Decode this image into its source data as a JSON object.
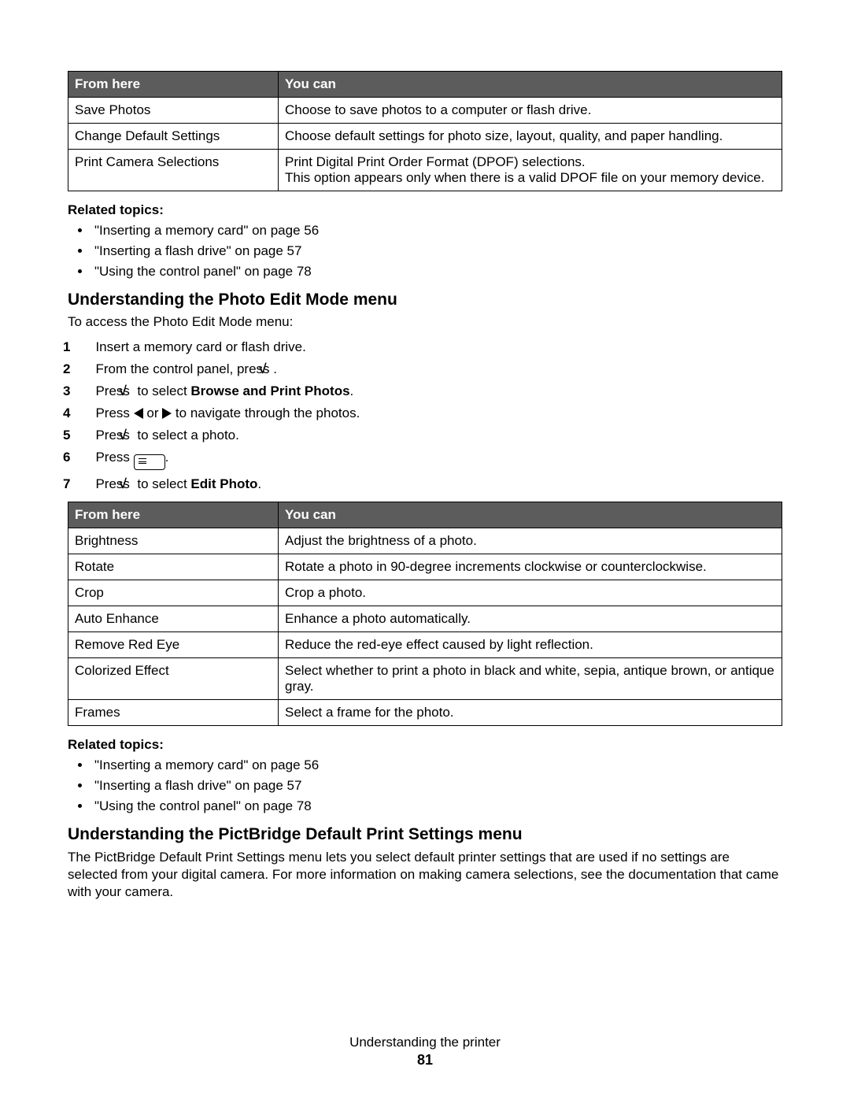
{
  "table1": {
    "headers": {
      "from": "From here",
      "you": "You can"
    },
    "rows": [
      {
        "from": "Save Photos",
        "you": "Choose to save photos to a computer or flash drive."
      },
      {
        "from": "Change Default Settings",
        "you": "Choose default settings for photo size, layout, quality, and paper handling."
      },
      {
        "from": "Print Camera Selections",
        "you": "Print Digital Print Order Format (DPOF) selections.\nThis option appears only when there is a valid DPOF file on your memory device."
      }
    ]
  },
  "related1": {
    "heading": "Related topics:",
    "items": [
      "\"Inserting a memory card\" on page 56",
      "\"Inserting a flash drive\" on page 57",
      "\"Using the control panel\" on page 78"
    ]
  },
  "section_photo_edit": {
    "heading": "Understanding the Photo Edit Mode menu",
    "intro": "To access the Photo Edit Mode menu:",
    "steps": {
      "s1": "Insert a memory card or flash drive.",
      "s2a": "From the control panel, press ",
      "s3a": "Press ",
      "s3b": " to select ",
      "s3c": "Browse and Print Photos",
      "s4a": "Press ",
      "s4b": " or ",
      "s4c": " to navigate through the photos.",
      "s5a": "Press ",
      "s5b": " to select a photo.",
      "s6a": "Press ",
      "s7a": "Press ",
      "s7b": " to select ",
      "s7c": "Edit Photo",
      "dot": "."
    }
  },
  "table2": {
    "headers": {
      "from": "From here",
      "you": "You can"
    },
    "rows": [
      {
        "from": "Brightness",
        "you": "Adjust the brightness of a photo."
      },
      {
        "from": "Rotate",
        "you": "Rotate a photo in 90-degree increments clockwise or counterclockwise."
      },
      {
        "from": "Crop",
        "you": "Crop a photo."
      },
      {
        "from": "Auto Enhance",
        "you": "Enhance a photo automatically."
      },
      {
        "from": "Remove Red Eye",
        "you": "Reduce the red-eye effect caused by light reflection."
      },
      {
        "from": "Colorized Effect",
        "you": "Select whether to print a photo in black and white, sepia, antique brown, or antique gray."
      },
      {
        "from": "Frames",
        "you": "Select a frame for the photo."
      }
    ]
  },
  "related2": {
    "heading": "Related topics:",
    "items": [
      "\"Inserting a memory card\" on page 56",
      "\"Inserting a flash drive\" on page 57",
      "\"Using the control panel\" on page 78"
    ]
  },
  "section_pictbridge": {
    "heading": "Understanding the PictBridge Default Print Settings menu",
    "para": "The PictBridge Default Print Settings menu lets you select default printer settings that are used if no settings are selected from your digital camera. For more information on making camera selections, see the documentation that came with your camera."
  },
  "footer": {
    "title": "Understanding the printer",
    "page": "81"
  }
}
